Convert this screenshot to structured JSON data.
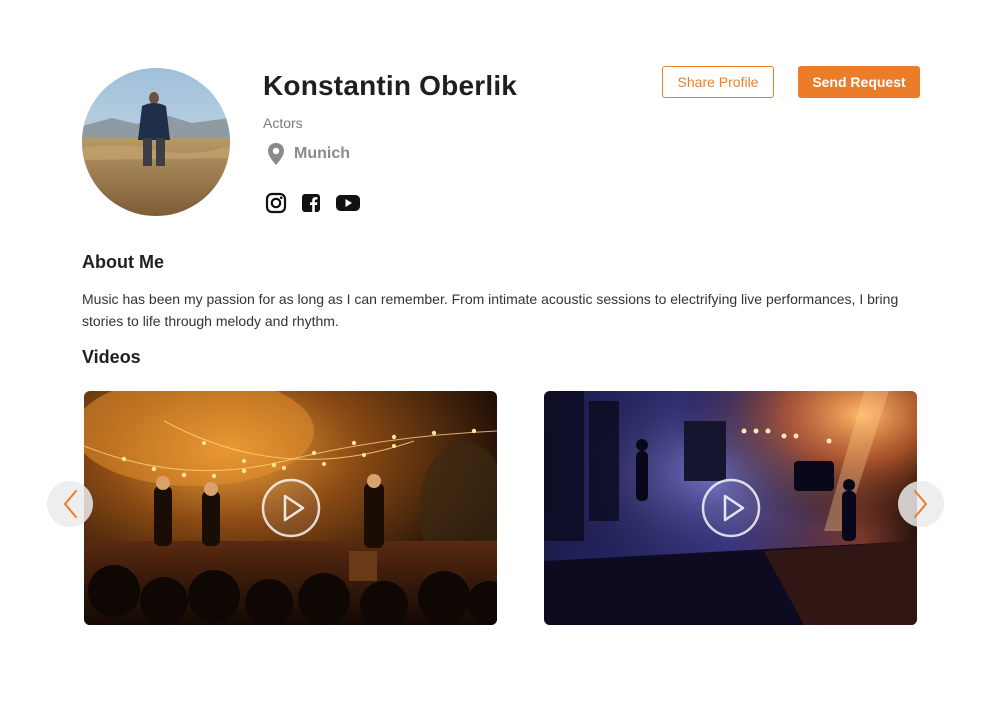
{
  "profile": {
    "name": "Konstantin Oberlik",
    "role": "Actors",
    "location": "Munich"
  },
  "socials": [
    {
      "icon": "instagram-icon"
    },
    {
      "icon": "facebook-icon"
    },
    {
      "icon": "youtube-icon"
    }
  ],
  "actions": {
    "share_label": "Share Profile",
    "send_label": "Send Request"
  },
  "about": {
    "title": "About Me",
    "text": "Music has been my passion for as long as I can remember. From intimate acoustic sessions to electrifying live performances, I bring stories to life through melody and rhythm."
  },
  "videos": {
    "title": "Videos",
    "items": [
      {
        "thumbnail": "outdoor-night-concert",
        "icon": "play-icon"
      },
      {
        "thumbnail": "indoor-stage-concert",
        "icon": "play-icon"
      }
    ]
  },
  "colors": {
    "accent": "#ea7c2a",
    "text_dark": "#1f1f1f",
    "text_muted": "#7a7a7a"
  }
}
